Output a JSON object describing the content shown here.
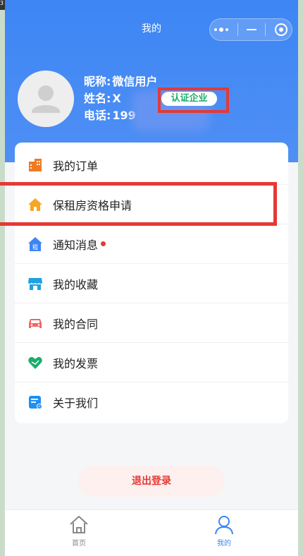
{
  "corner": {
    "text": "3"
  },
  "nav": {
    "title": "我的"
  },
  "profile": {
    "nickname_label": "昵称:",
    "nickname": "微信用户",
    "name_label": "姓名:",
    "name": "X",
    "phone_label": "电话:",
    "phone": "199",
    "cert_badge": "认证企业"
  },
  "menu": {
    "items": [
      {
        "label": "我的订单",
        "icon": "building-icon",
        "color": "#f07a22"
      },
      {
        "label": "保租房资格申请",
        "icon": "house-icon",
        "color": "#f5a623"
      },
      {
        "label": "通知消息",
        "icon": "rent-house-icon",
        "color": "#3d86f4",
        "unread": true
      },
      {
        "label": "我的收藏",
        "icon": "shop-icon",
        "color": "#1fa2e0"
      },
      {
        "label": "我的合同",
        "icon": "car-icon",
        "color": "#f06565"
      },
      {
        "label": "我的发票",
        "icon": "heart-icon",
        "color": "#1aad6b"
      },
      {
        "label": "关于我们",
        "icon": "document-icon",
        "color": "#1f8ff0"
      }
    ]
  },
  "logout": {
    "label": "退出登录"
  },
  "tabbar": {
    "home_label": "首页",
    "mine_label": "我的"
  },
  "colors": {
    "primary": "#3d86f4",
    "danger": "#e53935",
    "success": "#1aad6b"
  }
}
